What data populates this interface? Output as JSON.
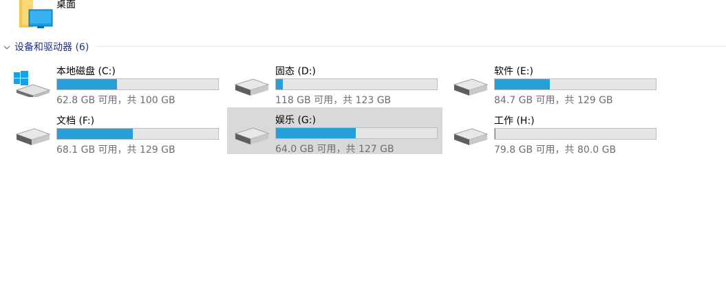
{
  "folder": {
    "label": "桌面",
    "icon": "desktop-folder-icon"
  },
  "group": {
    "title": "设备和驱动器 (6)",
    "icon": "chevron-down-icon"
  },
  "colors": {
    "bar_fill": "#26a0da",
    "bar_track": "#e6e6e6",
    "group_title": "#1e3287",
    "selected_bg": "#d9d9d9"
  },
  "drives": [
    {
      "name": "本地磁盘 (C:)",
      "free_text": "62.8 GB 可用，共 100 GB",
      "used_fraction": 0.372,
      "icon": "windows-drive-icon",
      "selected": false
    },
    {
      "name": "固态 (D:)",
      "free_text": "118 GB 可用，共 123 GB",
      "used_fraction": 0.041,
      "icon": "hard-drive-icon",
      "selected": false
    },
    {
      "name": "软件 (E:)",
      "free_text": "84.7 GB 可用，共 129 GB",
      "used_fraction": 0.343,
      "icon": "hard-drive-icon",
      "selected": false
    },
    {
      "name": "文档 (F:)",
      "free_text": "68.1 GB 可用，共 129 GB",
      "used_fraction": 0.472,
      "icon": "hard-drive-icon",
      "selected": false
    },
    {
      "name": "娱乐 (G:)",
      "free_text": "64.0 GB 可用，共 127 GB",
      "used_fraction": 0.496,
      "icon": "hard-drive-icon",
      "selected": true
    },
    {
      "name": "工作 (H:)",
      "free_text": "79.8 GB 可用，共 80.0 GB",
      "used_fraction": 0.003,
      "icon": "hard-drive-icon",
      "selected": false
    }
  ]
}
